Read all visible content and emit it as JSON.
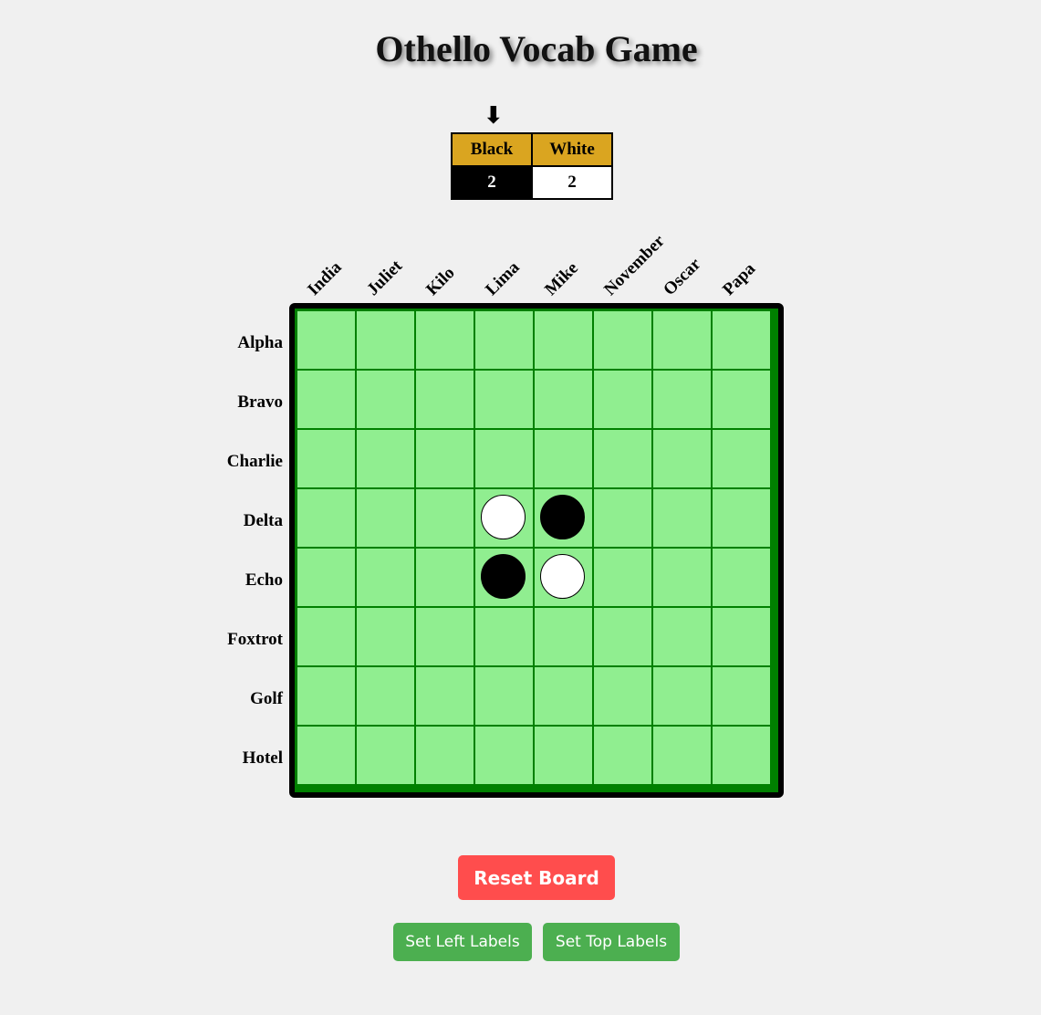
{
  "title": "Othello Vocab Game",
  "turn_indicator": "⬇",
  "score": {
    "black_label": "Black",
    "white_label": "White",
    "black_count": "2",
    "white_count": "2"
  },
  "top_labels": [
    "India",
    "Juliet",
    "Kilo",
    "Lima",
    "Mike",
    "November",
    "Oscar",
    "Papa"
  ],
  "left_labels": [
    "Alpha",
    "Bravo",
    "Charlie",
    "Delta",
    "Echo",
    "Foxtrot",
    "Golf",
    "Hotel"
  ],
  "board": [
    [
      "",
      "",
      "",
      "",
      "",
      "",
      "",
      ""
    ],
    [
      "",
      "",
      "",
      "",
      "",
      "",
      "",
      ""
    ],
    [
      "",
      "",
      "",
      "",
      "",
      "",
      "",
      ""
    ],
    [
      "",
      "",
      "",
      "W",
      "B",
      "",
      "",
      ""
    ],
    [
      "",
      "",
      "",
      "B",
      "W",
      "",
      "",
      ""
    ],
    [
      "",
      "",
      "",
      "",
      "",
      "",
      "",
      ""
    ],
    [
      "",
      "",
      "",
      "",
      "",
      "",
      "",
      ""
    ],
    [
      "",
      "",
      "",
      "",
      "",
      "",
      "",
      ""
    ]
  ],
  "buttons": {
    "reset": "Reset Board",
    "set_left": "Set Left Labels",
    "set_top": "Set Top Labels"
  },
  "colors": {
    "board_cell": "#90ee90",
    "board_grid": "#008000",
    "score_header": "#daa520",
    "reset_button": "#ff4d4d",
    "label_button": "#4caf50"
  }
}
